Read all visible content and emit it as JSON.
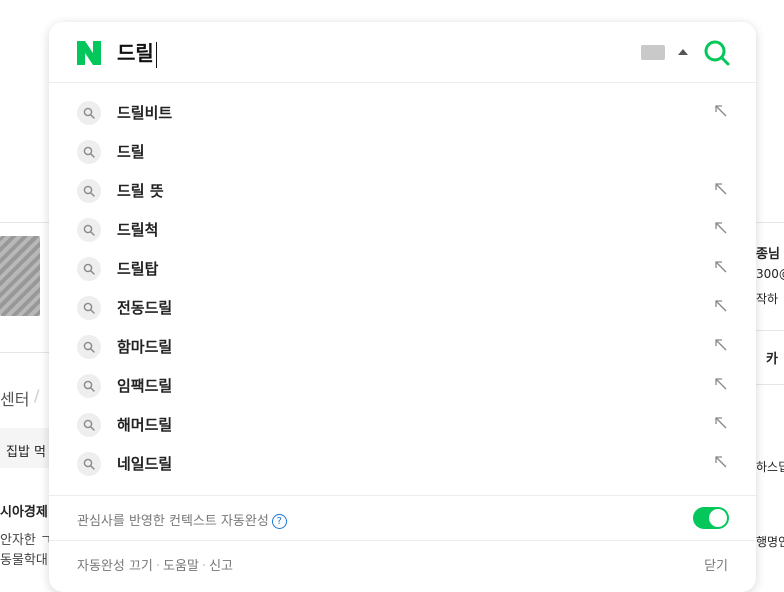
{
  "search": {
    "query": "드릴",
    "logo_letter": "N"
  },
  "suggestions": [
    {
      "label": "드릴비트",
      "has_arrow": true
    },
    {
      "label": "드릴",
      "has_arrow": false
    },
    {
      "label": "드릴 뜻",
      "has_arrow": true
    },
    {
      "label": "드릴척",
      "has_arrow": true
    },
    {
      "label": "드릴탑",
      "has_arrow": true
    },
    {
      "label": "전동드릴",
      "has_arrow": true
    },
    {
      "label": "함마드릴",
      "has_arrow": true
    },
    {
      "label": "임팩드릴",
      "has_arrow": true
    },
    {
      "label": "해머드릴",
      "has_arrow": true
    },
    {
      "label": "네일드릴",
      "has_arrow": true
    }
  ],
  "context": {
    "label": "관심사를 반영한 컨텍스트 자동완성",
    "info": "?",
    "toggle_on": true
  },
  "footer": {
    "autocomplete_off": "자동완성 끄기",
    "help": "도움말",
    "report": "신고",
    "sep": "·",
    "close": "닫기"
  },
  "background": {
    "left_texts": [
      "센터",
      "/",
      "집밥 먹",
      "시아경제",
      "안자한 ㄱ",
      "동물학대"
    ],
    "right_texts": [
      "종님",
      "300@",
      "작하",
      "카",
      "하스딥",
      "행명인"
    ]
  },
  "colors": {
    "brand_green": "#03c75a",
    "info_blue": "#1976d2"
  }
}
